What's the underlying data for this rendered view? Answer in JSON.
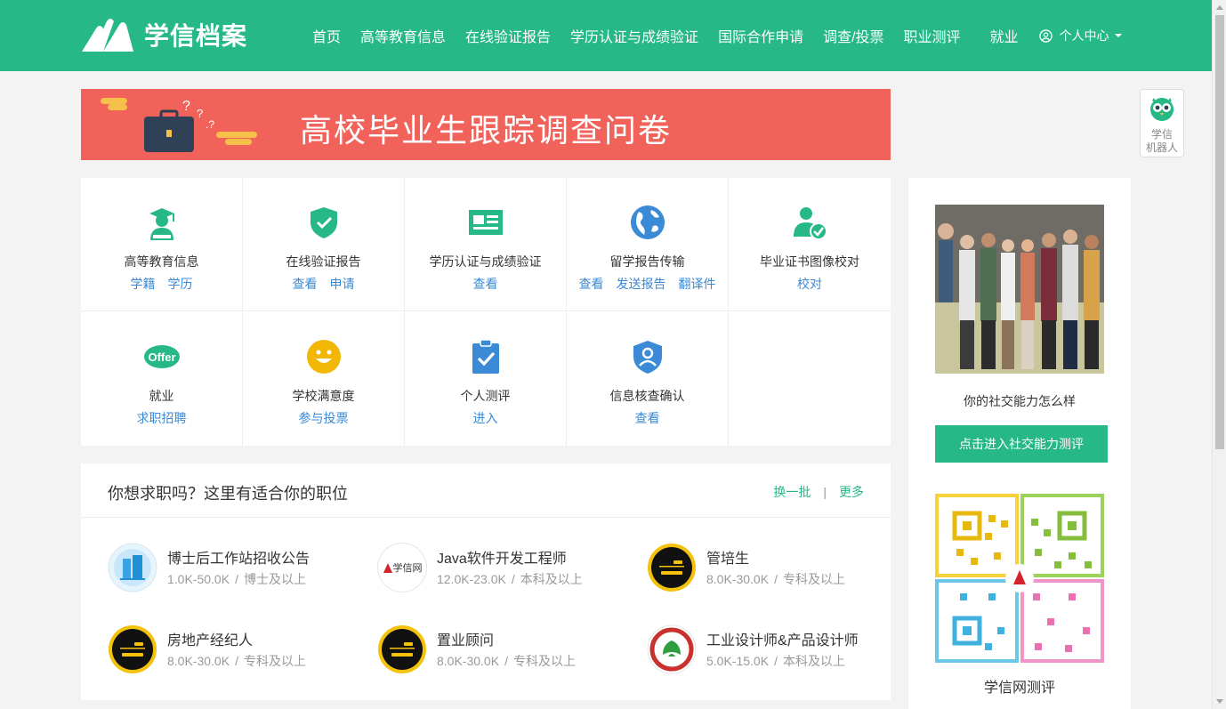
{
  "header": {
    "logo_text": "学信档案",
    "nav": [
      "首页",
      "高等教育信息",
      "在线验证报告",
      "学历认证与成绩验证",
      "国际合作申请",
      "调查/投票",
      "职业测评",
      "就业"
    ],
    "user_menu": "个人中心"
  },
  "banner": {
    "title": "高校毕业生跟踪调查问卷"
  },
  "robot": {
    "line1": "学信",
    "line2": "机器人"
  },
  "services": [
    {
      "name": "高等教育信息",
      "links": [
        "学籍",
        "学历"
      ],
      "icon": "graduate-icon"
    },
    {
      "name": "在线验证报告",
      "links": [
        "查看",
        "申请"
      ],
      "icon": "shield-check-icon"
    },
    {
      "name": "学历认证与成绩验证",
      "links": [
        "查看"
      ],
      "icon": "certificate-card-icon"
    },
    {
      "name": "留学报告传输",
      "links": [
        "查看",
        "发送报告",
        "翻译件"
      ],
      "icon": "globe-icon"
    },
    {
      "name": "毕业证书图像校对",
      "links": [
        "校对"
      ],
      "icon": "user-check-icon"
    },
    {
      "name": "就业",
      "links": [
        "求职招聘"
      ],
      "icon": "offer-icon"
    },
    {
      "name": "学校满意度",
      "links": [
        "参与投票"
      ],
      "icon": "smile-icon"
    },
    {
      "name": "个人测评",
      "links": [
        "进入"
      ],
      "icon": "clipboard-check-icon"
    },
    {
      "name": "信息核查确认",
      "links": [
        "查看"
      ],
      "icon": "shield-user-icon"
    }
  ],
  "jobs": {
    "title": "你想求职吗？这里有适合你的职位",
    "refresh": "换一批",
    "more": "更多",
    "items": [
      {
        "title": "博士后工作站招收公告",
        "salary": "1.0K-50.0K",
        "edu": "博士及以上"
      },
      {
        "title": "Java软件开发工程师",
        "salary": "12.0K-23.0K",
        "edu": "本科及以上",
        "logo_text": "学信网"
      },
      {
        "title": "管培生",
        "salary": "8.0K-30.0K",
        "edu": "专科及以上"
      },
      {
        "title": "房地产经纪人",
        "salary": "8.0K-30.0K",
        "edu": "专科及以上"
      },
      {
        "title": "置业顾问",
        "salary": "8.0K-30.0K",
        "edu": "专科及以上"
      },
      {
        "title": "工业设计师&产品设计师",
        "salary": "5.0K-15.0K",
        "edu": "本科及以上"
      }
    ]
  },
  "sidebar": {
    "caption": "你的社交能力怎么样",
    "button": "点击进入社交能力测评",
    "qr_caption": "学信网测评"
  },
  "colors": {
    "primary": "#26b887",
    "banner": "#f0625a",
    "link": "#3a8ad6"
  }
}
